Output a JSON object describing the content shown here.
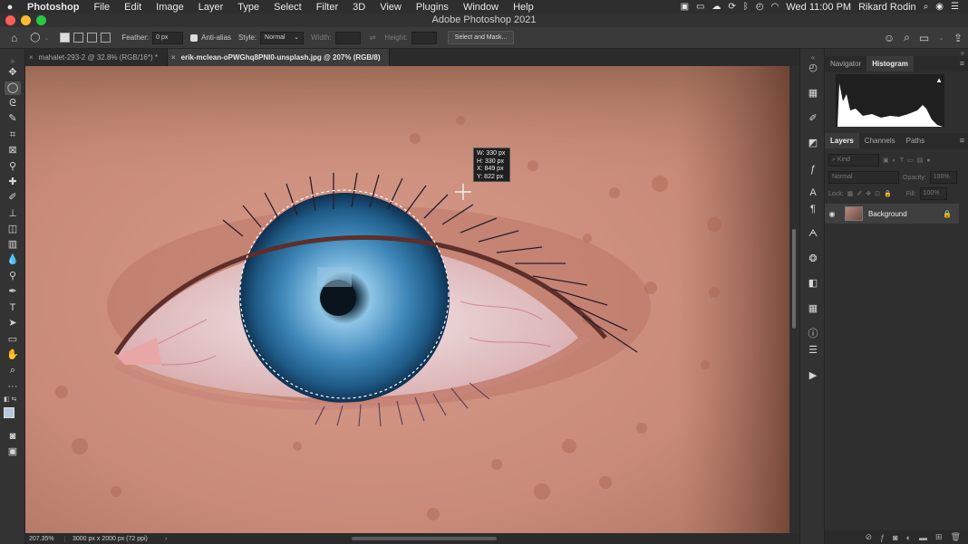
{
  "menubar": {
    "app_name": "Photoshop",
    "items": [
      "File",
      "Edit",
      "Image",
      "Layer",
      "Type",
      "Select",
      "Filter",
      "3D",
      "View",
      "Plugins",
      "Window",
      "Help"
    ],
    "datetime": "Wed 11:00 PM",
    "user": "Rikard Rodin"
  },
  "window": {
    "title": "Adobe Photoshop 2021"
  },
  "options": {
    "feather_label": "Feather:",
    "feather_value": "0 px",
    "antialias_label": "Anti-alias",
    "style_label": "Style:",
    "style_value": "Normal",
    "width_label": "Width:",
    "height_label": "Height:",
    "select_mask_label": "Select and Mask..."
  },
  "tabs": [
    {
      "label": "mahalet-293-2 @ 32.8% (RGB/16*) *"
    },
    {
      "label": "erik-mclean-oPWGhq8PNI0-unsplash.jpg @ 207% (RGB/8)"
    }
  ],
  "selection_info": {
    "w": "W: 330 px",
    "h": "H: 330 px",
    "x": "X: 849 px",
    "y": "Y: 822 px"
  },
  "status": {
    "zoom": "207.35%",
    "doc_info": "3000 px x 2000 px (72 ppi)"
  },
  "panels": {
    "top_tabs": [
      "Navigator",
      "Histogram"
    ],
    "layer_tabs": [
      "Layers",
      "Channels",
      "Paths"
    ],
    "kind_placeholder": "Kind",
    "blend_mode": "Normal",
    "opacity_label": "Opacity:",
    "opacity_value": "100%",
    "lock_label": "Lock:",
    "fill_label": "Fill:",
    "fill_value": "100%",
    "layer_name": "Background"
  },
  "colors": {
    "accent": "#4a90d9",
    "selection": "#ffffff",
    "panel_bg": "#2f2f2f"
  }
}
